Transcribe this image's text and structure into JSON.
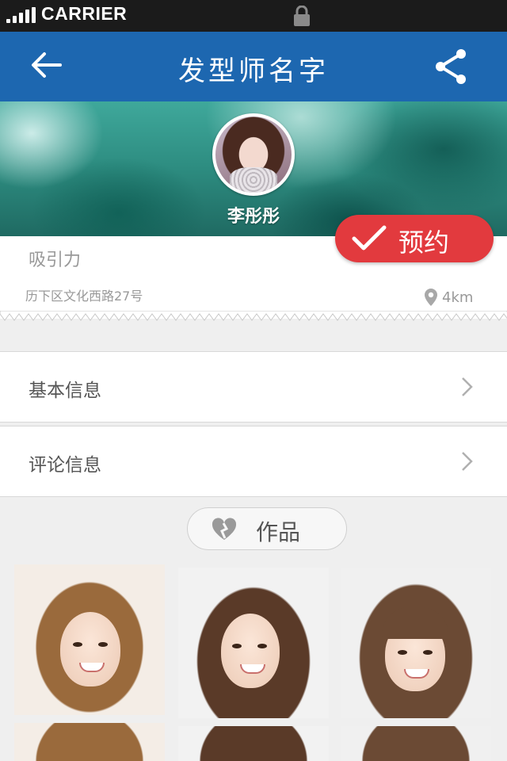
{
  "status_bar": {
    "carrier": "CARRIER"
  },
  "nav": {
    "title": "发型师名字",
    "back_icon": "arrow-left-icon",
    "share_icon": "share-icon"
  },
  "profile": {
    "name": "李彤彤",
    "tagline": "吸引力",
    "address": "历下区文化西路27号",
    "distance": "4km"
  },
  "book_button": {
    "label": "预约",
    "color": "#e23a3e"
  },
  "menu": [
    {
      "label": "基本信息"
    },
    {
      "label": "评论信息"
    }
  ],
  "works": {
    "label": "作品"
  },
  "colors": {
    "nav": "#1d67b0",
    "accent": "#e23a3e",
    "status_bar": "#1b1b1b"
  }
}
